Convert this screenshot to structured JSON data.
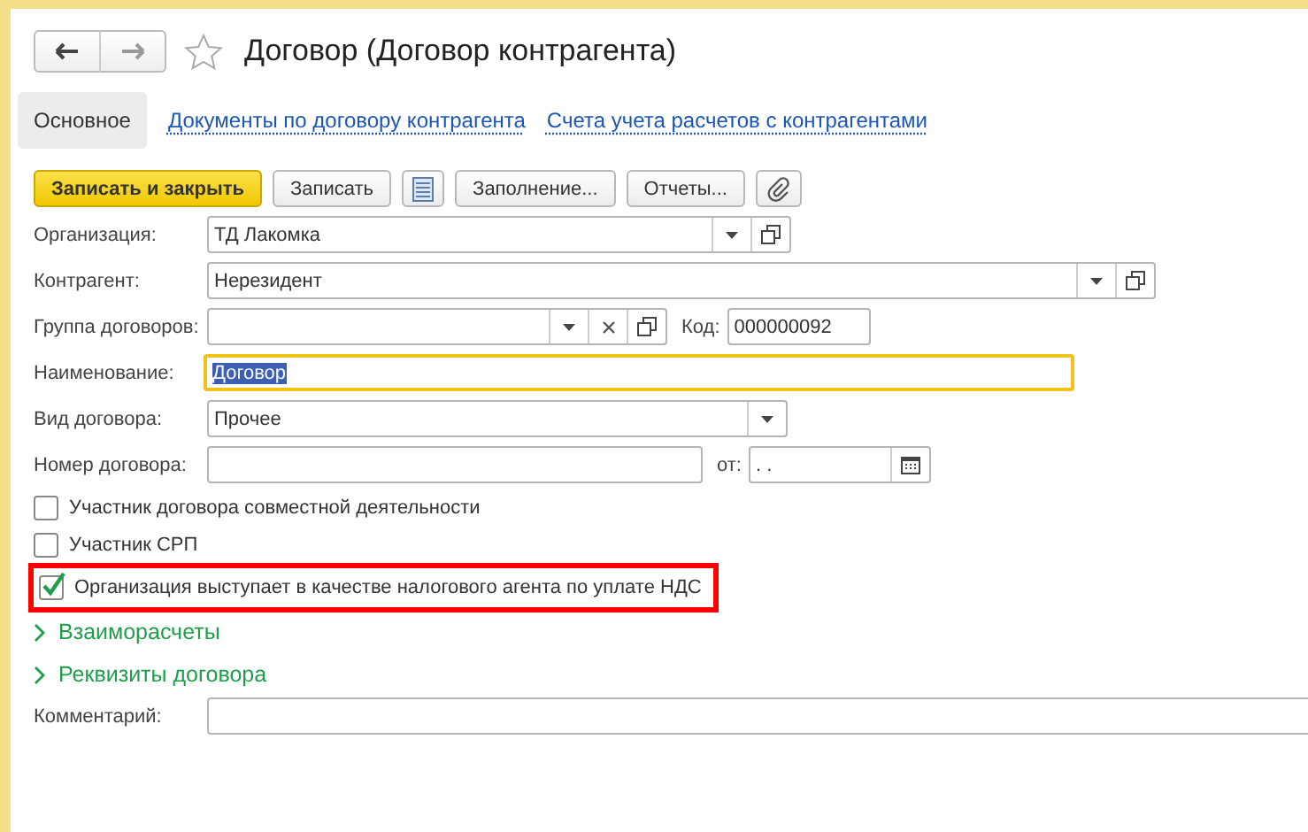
{
  "window": {
    "title": "Договор (Договор контрагента)",
    "favorite": false
  },
  "tabs": [
    {
      "label": "Основное",
      "selected": true
    },
    {
      "label": "Документы по договору контрагента",
      "selected": false
    },
    {
      "label": "Счета учета расчетов с контрагентами",
      "selected": false
    }
  ],
  "toolbar": [
    {
      "kind": "primary",
      "label": "Записать и закрыть"
    },
    {
      "kind": "text",
      "label": "Записать"
    },
    {
      "kind": "list"
    },
    {
      "kind": "text",
      "label": "Заполнение..."
    },
    {
      "kind": "text",
      "label": "Отчеты..."
    },
    {
      "kind": "attach"
    }
  ],
  "fields": [
    {
      "kind": "select-open",
      "label": "Организация:",
      "value": "ТД Лакомка",
      "focused": false
    },
    {
      "kind": "select-open",
      "label": "Контрагент:",
      "value": "Нерезидент",
      "focused": false
    },
    {
      "kind": "select-clear-open",
      "label": "Группа договоров:",
      "focused": false,
      "extra": {
        "label": "Код:",
        "value": "000000092"
      }
    },
    {
      "kind": "text",
      "label": "Наименование:",
      "value": "Договор",
      "focused": true
    },
    {
      "kind": "select",
      "label": "Вид договора:",
      "value": "Прочее",
      "focused": false
    },
    {
      "kind": "text",
      "label": "Номер договора:",
      "focused": false,
      "extra": {
        "label": "от:",
        "value": " .  ."
      }
    }
  ],
  "checkboxes": [
    {
      "label": "Участник договора совместной деятельности",
      "checked": false,
      "highlighted": false
    },
    {
      "label": "Участник СРП",
      "checked": false,
      "highlighted": false
    },
    {
      "label": "Организация выступает в качестве налогового агента по уплате НДС",
      "checked": true,
      "highlighted": true
    }
  ],
  "groups": [
    {
      "label": "Взаиморасчеты",
      "expanded": false
    },
    {
      "label": "Реквизиты договора",
      "expanded": false
    }
  ],
  "comment": {
    "label": "Комментарий:"
  }
}
